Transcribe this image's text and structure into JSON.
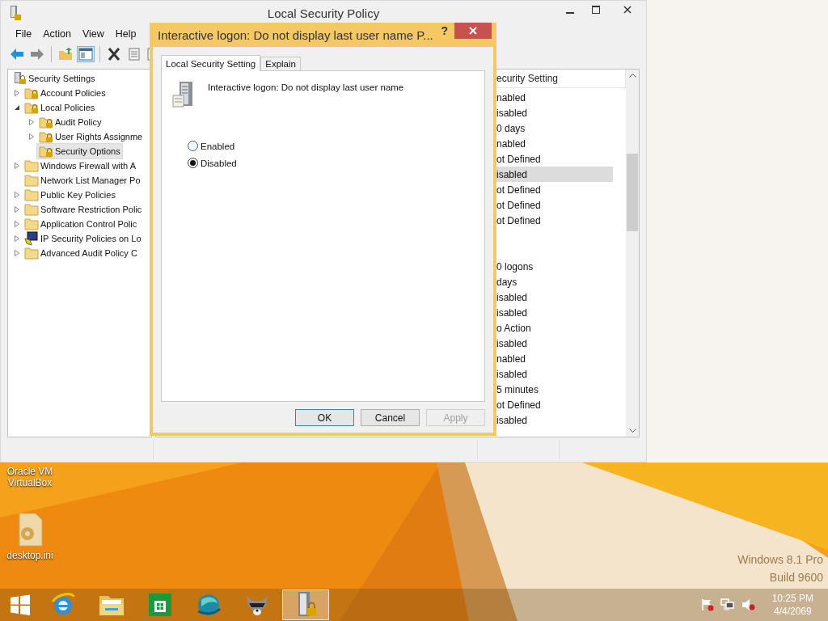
{
  "main_window": {
    "title": "Local Security Policy",
    "menu": [
      "File",
      "Action",
      "View",
      "Help"
    ],
    "tree": [
      {
        "label": "Security Settings",
        "kind": "root",
        "selected": false,
        "children": [
          {
            "label": "Account Policies",
            "kind": "lock-folder",
            "expanded": false,
            "selected": false
          },
          {
            "label": "Local Policies",
            "kind": "lock-folder",
            "expanded": true,
            "selected": false,
            "children": [
              {
                "label": "Audit Policy",
                "kind": "lock-folder",
                "expanded": false,
                "selected": false
              },
              {
                "label": "User Rights Assignme",
                "kind": "lock-folder",
                "expanded": false,
                "selected": false
              },
              {
                "label": "Security Options",
                "kind": "lock-folder",
                "selected": true
              }
            ]
          },
          {
            "label": "Windows Firewall with A",
            "kind": "folder",
            "expanded": false,
            "selected": false
          },
          {
            "label": "Network List Manager Po",
            "kind": "folder",
            "selected": false
          },
          {
            "label": "Public Key Policies",
            "kind": "folder",
            "expanded": false,
            "selected": false
          },
          {
            "label": "Software Restriction Polic",
            "kind": "folder",
            "expanded": false,
            "selected": false
          },
          {
            "label": "Application Control Polic",
            "kind": "folder",
            "expanded": false,
            "selected": false
          },
          {
            "label": "IP Security Policies on Lo",
            "kind": "network",
            "expanded": false,
            "selected": false
          },
          {
            "label": "Advanced Audit Policy C",
            "kind": "folder",
            "expanded": false,
            "selected": false
          }
        ]
      }
    ],
    "list": {
      "column": "ecurity Setting",
      "rows": [
        {
          "kind": "value",
          "value": "nabled",
          "selected": false
        },
        {
          "kind": "value",
          "value": "isabled",
          "selected": false
        },
        {
          "kind": "value",
          "value": "0 days",
          "selected": false
        },
        {
          "kind": "value",
          "value": "nabled",
          "selected": false
        },
        {
          "kind": "value",
          "value": "ot Defined",
          "selected": false
        },
        {
          "kind": "value",
          "value": "isabled",
          "selected": true
        },
        {
          "kind": "value",
          "value": "ot Defined",
          "selected": false
        },
        {
          "kind": "value",
          "value": "ot Defined",
          "selected": false
        },
        {
          "kind": "value",
          "value": "ot Defined",
          "selected": false
        },
        {
          "kind": "blank"
        },
        {
          "kind": "blank"
        },
        {
          "kind": "value",
          "value": "0 logons",
          "selected": false
        },
        {
          "kind": "value",
          "value": "days",
          "selected": false
        },
        {
          "kind": "value",
          "value": "isabled",
          "selected": false
        },
        {
          "kind": "value",
          "value": "isabled",
          "selected": false
        },
        {
          "kind": "value",
          "value": "o Action",
          "selected": false
        },
        {
          "kind": "value",
          "value": "isabled",
          "selected": false
        },
        {
          "kind": "value",
          "value": "nabled",
          "selected": false
        },
        {
          "kind": "value",
          "value": "isabled",
          "selected": false
        },
        {
          "kind": "value",
          "value": "5 minutes",
          "selected": false
        },
        {
          "kind": "value",
          "value": "ot Defined",
          "selected": false
        },
        {
          "kind": "value",
          "value": "isabled",
          "selected": false
        }
      ]
    }
  },
  "dialog": {
    "title": "Interactive logon: Do not display last user name P...",
    "help": "?",
    "tabs": [
      {
        "label": "Local Security Setting",
        "selected": true
      },
      {
        "label": "Explain",
        "selected": false
      }
    ],
    "policy_name": "Interactive logon: Do not display last user name",
    "options": [
      {
        "label": "Enabled",
        "selected": false
      },
      {
        "label": "Disabled",
        "selected": true
      }
    ],
    "buttons": [
      {
        "label": "OK",
        "focused": true,
        "disabled": false
      },
      {
        "label": "Cancel",
        "focused": false,
        "disabled": false
      },
      {
        "label": "Apply",
        "focused": false,
        "disabled": true
      }
    ]
  },
  "desktop_icons": [
    {
      "label": "Oracle VM VirtualBox",
      "kind": "hidden-icon"
    },
    {
      "label": "desktop.ini",
      "kind": "settings-file"
    }
  ],
  "edition_text": [
    "Windows 8.1 Pro",
    "Build 9600"
  ],
  "taskbar": {
    "apps": [
      {
        "kind": "browser",
        "selected": false
      },
      {
        "kind": "folder",
        "selected": false
      },
      {
        "kind": "store",
        "selected": false
      },
      {
        "kind": "globe",
        "selected": false
      },
      {
        "kind": "raccoon",
        "selected": false
      },
      {
        "kind": "server",
        "selected": true
      }
    ],
    "clock": {
      "time": "10:25 PM",
      "date": "4/4/2069"
    }
  }
}
